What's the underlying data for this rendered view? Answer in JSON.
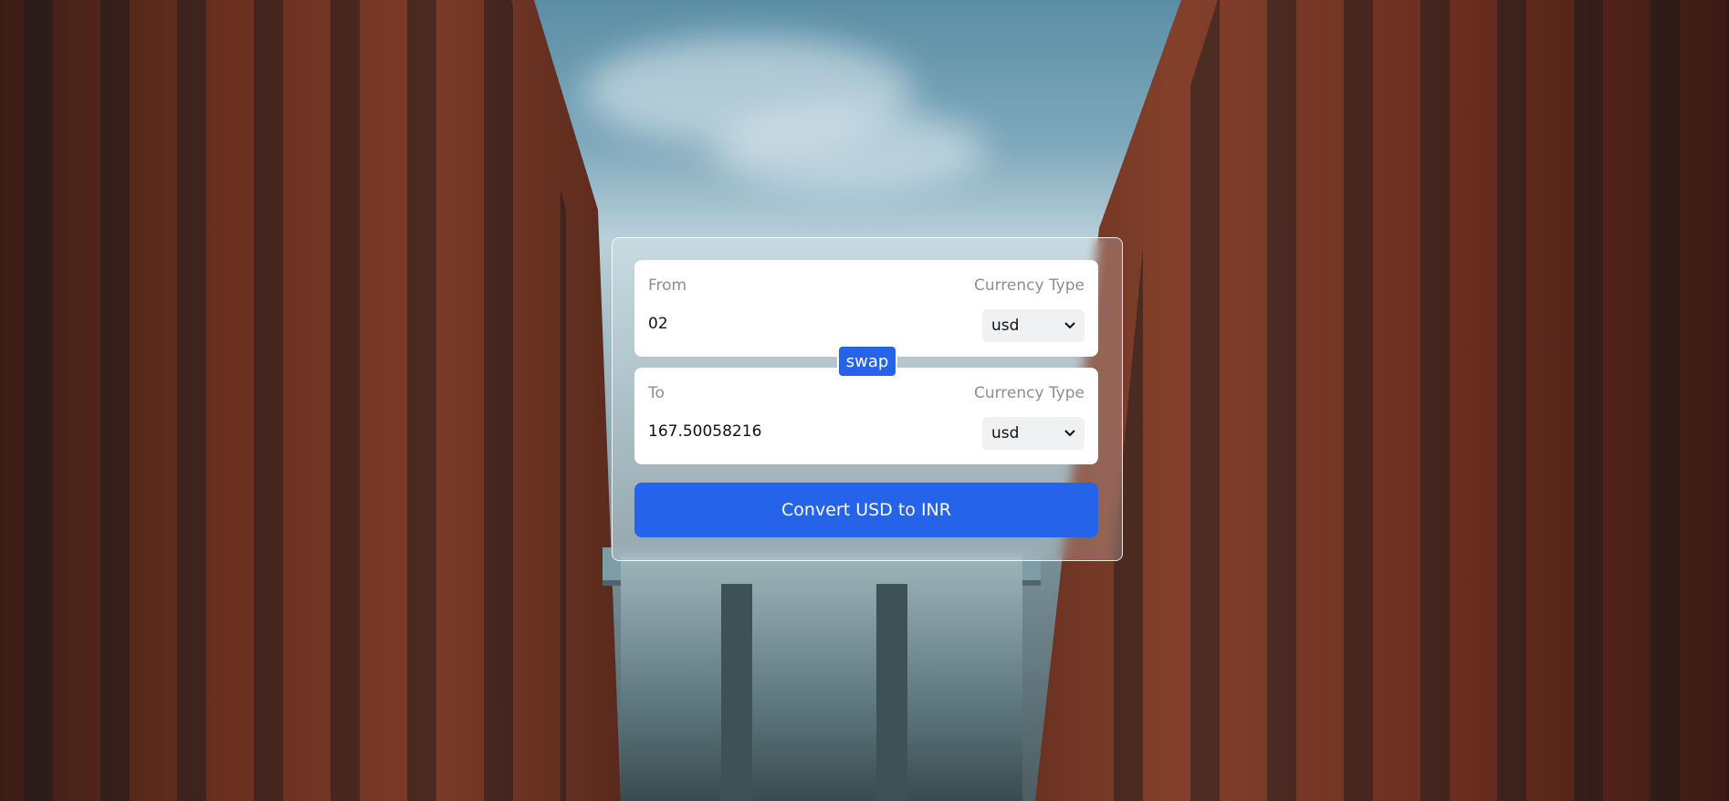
{
  "converter": {
    "from": {
      "label": "From",
      "currency_type_label": "Currency Type",
      "amount": "02",
      "currency": "usd"
    },
    "swap_label": "swap",
    "to": {
      "label": "To",
      "currency_type_label": "Currency Type",
      "amount": "167.50058216",
      "currency": "usd"
    },
    "convert_label": "Convert USD to INR"
  },
  "colors": {
    "accent": "#2563eb",
    "panel_border": "#ffffff",
    "label_gray": "#8a8f96"
  }
}
